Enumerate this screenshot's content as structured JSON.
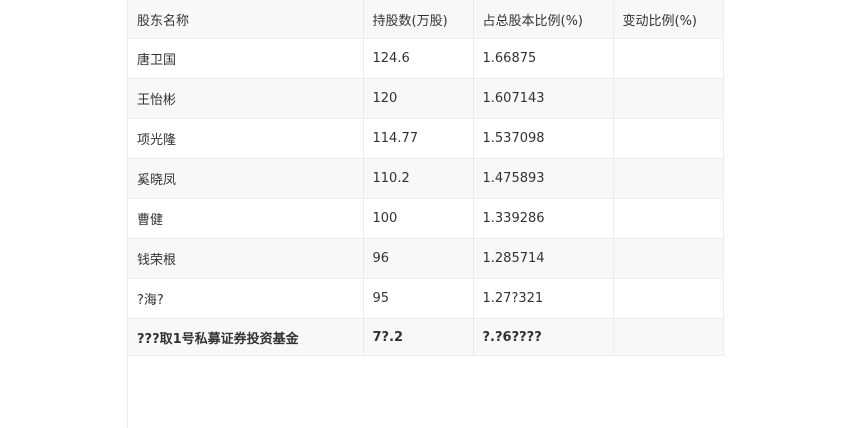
{
  "table": {
    "headers": [
      "股东名称",
      "持股数(万股)",
      "占总股本比例(%)",
      "变动比例(%)"
    ],
    "rows": [
      {
        "name": "唐卫国",
        "shares": "124.6",
        "ratio": "1.66875",
        "change": ""
      },
      {
        "name": "王怡彬",
        "shares": "120",
        "ratio": "1.607143",
        "change": ""
      },
      {
        "name": "项光隆",
        "shares": "114.77",
        "ratio": "1.537098",
        "change": ""
      },
      {
        "name": "奚晓凤",
        "shares": "110.2",
        "ratio": "1.475893",
        "change": ""
      },
      {
        "name": "曹健",
        "shares": "100",
        "ratio": "1.339286",
        "change": ""
      },
      {
        "name": "钱荣根",
        "shares": "96",
        "ratio": "1.285714",
        "change": ""
      },
      {
        "name": "?海?",
        "shares": "95",
        "ratio": "1.27?321",
        "change": ""
      },
      {
        "name": "???取1号私募证券投资基金",
        "shares": "7?.2",
        "ratio": "?.?6????",
        "change": ""
      }
    ]
  }
}
